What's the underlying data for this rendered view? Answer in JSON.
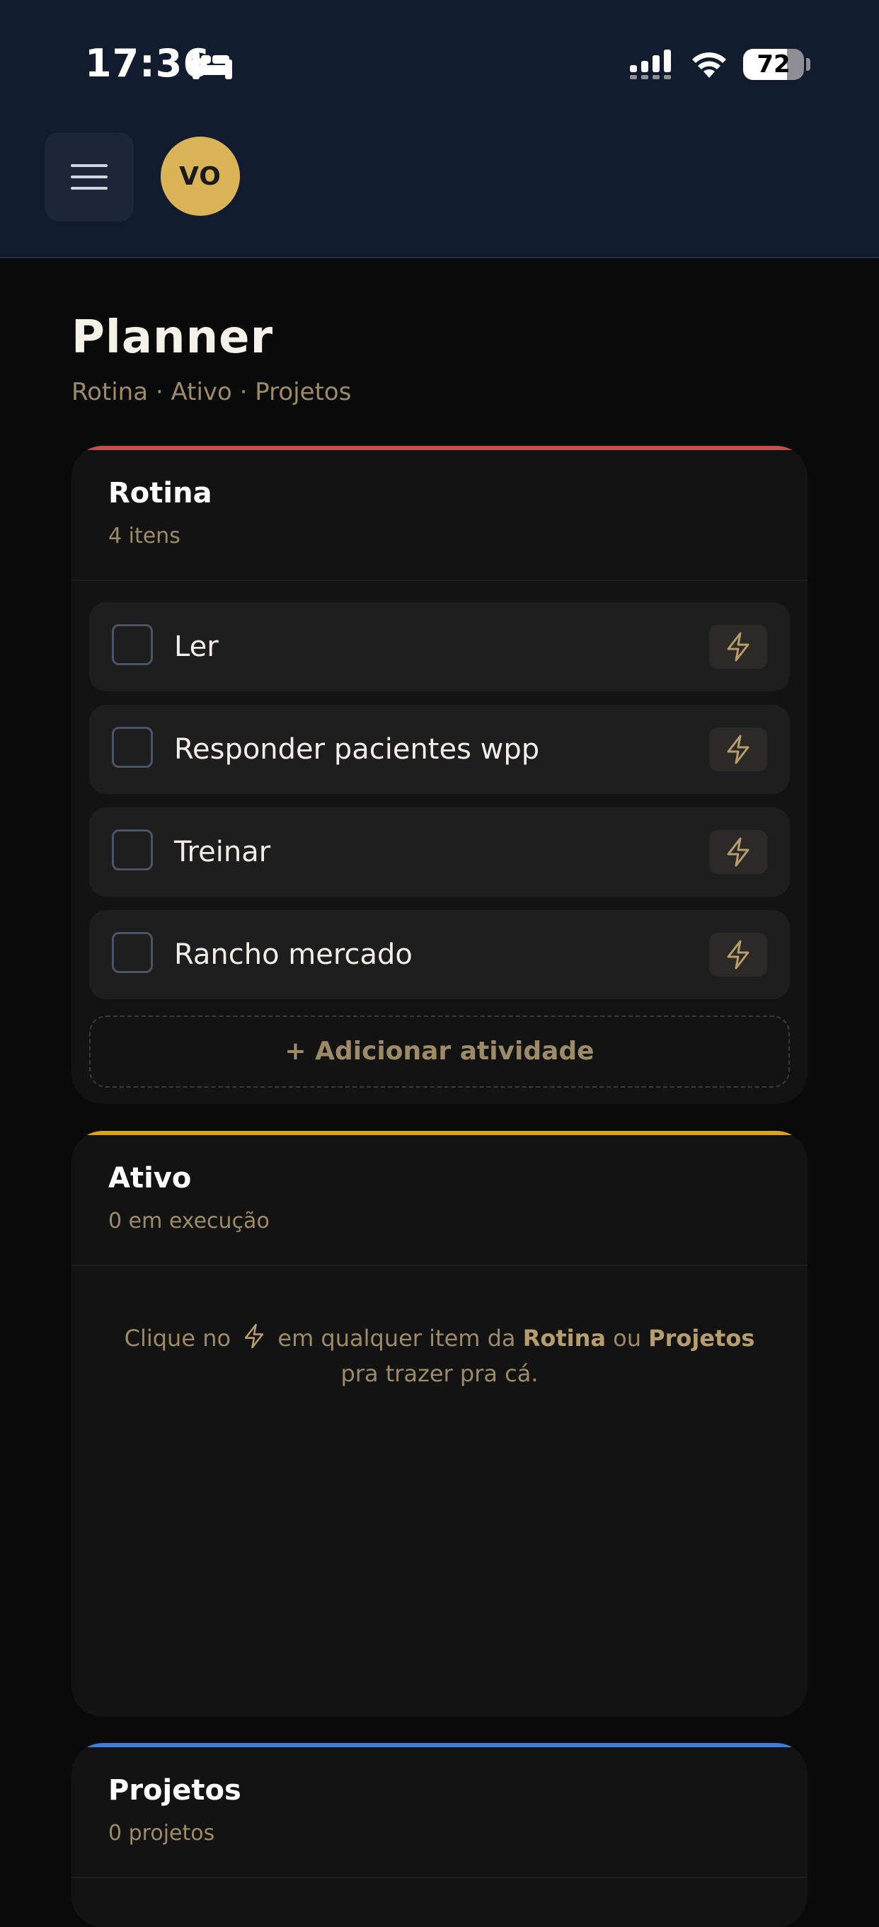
{
  "status_bar": {
    "time": "17:36",
    "battery_level": "72",
    "icons": [
      "bed-icon",
      "cellular-signal-icon",
      "wifi-icon",
      "battery-icon"
    ]
  },
  "header": {
    "menu_icon": "hamburger-menu-icon",
    "avatar_initials": "VO"
  },
  "page": {
    "title": "Planner",
    "subtitle": "Rotina · Ativo · Projetos"
  },
  "rotina": {
    "title": "Rotina",
    "count": "4 itens",
    "accent": "#c0504d",
    "items": [
      {
        "label": "Ler"
      },
      {
        "label": "Responder pacientes wpp"
      },
      {
        "label": "Treinar"
      },
      {
        "label": "Rancho mercado"
      }
    ],
    "add_label": "+ Adicionar atividade"
  },
  "ativo": {
    "title": "Ativo",
    "count": "0 em execução",
    "accent": "#d9a21f",
    "empty_text": {
      "part1": "Clique no",
      "part2": "em qualquer item da",
      "bold1": "Rotina",
      "part3": "ou",
      "bold2": "Projetos",
      "line2": "pra trazer pra cá."
    }
  },
  "projetos": {
    "title": "Projetos",
    "count": "0 projetos",
    "accent": "#3b7dd8"
  },
  "colors": {
    "header_bg": "#111c2e",
    "page_bg": "#0a0a0a",
    "gold": "#d9b356",
    "muted_gold": "#9c8b66"
  }
}
